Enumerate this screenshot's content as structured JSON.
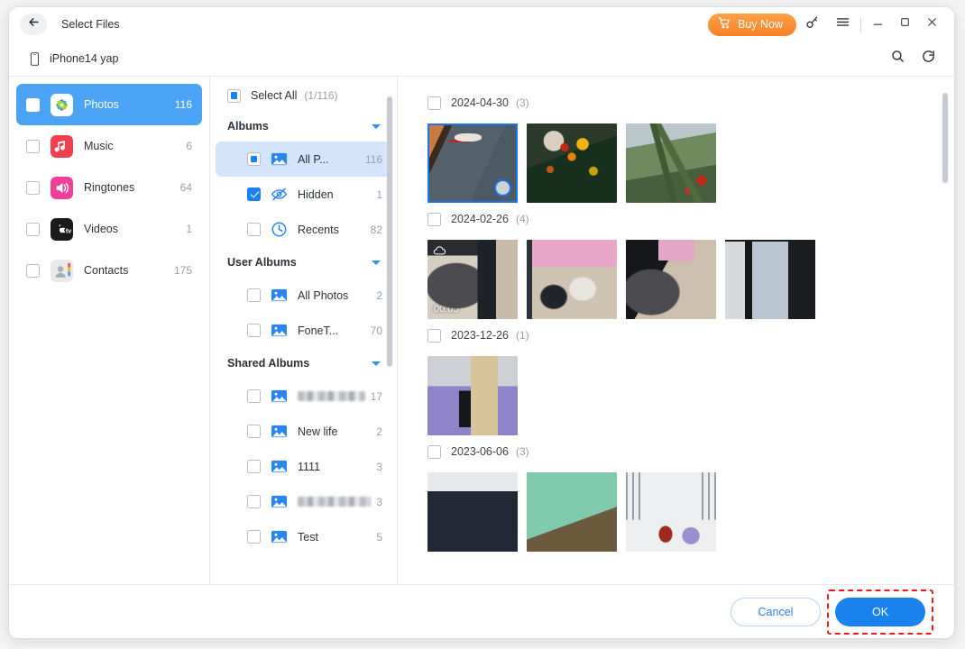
{
  "titlebar": {
    "back_icon": "arrow-left-icon",
    "title": "Select Files",
    "buy_now_label": "Buy Now",
    "cart_icon": "shopping-cart-icon",
    "key_icon": "key-icon",
    "menu_icon": "hamburger-menu-icon",
    "minimize_icon": "minimize-icon",
    "maximize_icon": "maximize-icon",
    "close_icon": "close-icon",
    "accent_orange": "#f98024"
  },
  "devicebar": {
    "device_icon": "phone-icon",
    "device_name": "iPhone14 yap",
    "search_icon": "search-icon",
    "refresh_icon": "refresh-icon"
  },
  "sidebar": {
    "items": [
      {
        "label": "Photos",
        "count": "116",
        "icon": "photos-app-icon",
        "checked": "indeterminate",
        "active": true
      },
      {
        "label": "Music",
        "count": "6",
        "icon": "music-app-icon",
        "checked": "unchecked",
        "active": false
      },
      {
        "label": "Ringtones",
        "count": "64",
        "icon": "ringtones-app-icon",
        "checked": "unchecked",
        "active": false
      },
      {
        "label": "Videos",
        "count": "1",
        "icon": "appletv-app-icon",
        "checked": "unchecked",
        "active": false
      },
      {
        "label": "Contacts",
        "count": "175",
        "icon": "contacts-app-icon",
        "checked": "unchecked",
        "active": false
      }
    ],
    "active_bg": "#4aa3f5"
  },
  "albums_panel": {
    "select_all_label": "Select All",
    "select_all_count": "(1/116)",
    "select_all_state": "indeterminate",
    "groups": [
      {
        "title": "Albums",
        "items": [
          {
            "label": "All P...",
            "count": "116",
            "icon": "image-icon",
            "checked": "indeterminate",
            "selected": true,
            "redacted": false
          },
          {
            "label": "Hidden",
            "count": "1",
            "icon": "eye-slash-icon",
            "checked": "checked",
            "selected": false,
            "redacted": false
          },
          {
            "label": "Recents",
            "count": "82",
            "icon": "clock-icon",
            "checked": "unchecked",
            "selected": false,
            "redacted": false
          }
        ]
      },
      {
        "title": "User Albums",
        "items": [
          {
            "label": "All Photos",
            "count": "2",
            "icon": "image-icon",
            "checked": "unchecked",
            "selected": false,
            "redacted": false
          },
          {
            "label": "FoneT...",
            "count": "70",
            "icon": "image-icon",
            "checked": "unchecked",
            "selected": false,
            "redacted": false
          }
        ]
      },
      {
        "title": "Shared Albums",
        "items": [
          {
            "label": "",
            "count": "17",
            "icon": "image-icon",
            "checked": "unchecked",
            "selected": false,
            "redacted": true
          },
          {
            "label": "New life",
            "count": "2",
            "icon": "image-icon",
            "checked": "unchecked",
            "selected": false,
            "redacted": false
          },
          {
            "label": "1111",
            "count": "3",
            "icon": "image-icon",
            "checked": "unchecked",
            "selected": false,
            "redacted": false
          },
          {
            "label": "",
            "count": "3",
            "icon": "image-icon",
            "checked": "unchecked",
            "selected": false,
            "redacted": true
          },
          {
            "label": "Test",
            "count": "5",
            "icon": "image-icon",
            "checked": "unchecked",
            "selected": false,
            "redacted": false
          }
        ]
      }
    ]
  },
  "photos_panel": {
    "groups": [
      {
        "date": "2024-04-30",
        "count": "(3)",
        "checked": "unchecked",
        "thumbs": [
          {
            "art": "t-rain",
            "selected": true,
            "cloud": false,
            "duration": ""
          },
          {
            "art": "t-arch",
            "selected": false,
            "cloud": false,
            "duration": ""
          },
          {
            "art": "t-plant",
            "selected": false,
            "cloud": false,
            "duration": ""
          }
        ]
      },
      {
        "date": "2024-02-26",
        "count": "(4)",
        "checked": "unchecked",
        "thumbs": [
          {
            "art": "t-desk1",
            "selected": false,
            "cloud": true,
            "duration": "00:05"
          },
          {
            "art": "t-desk2",
            "selected": false,
            "cloud": false,
            "duration": ""
          },
          {
            "art": "t-desk3",
            "selected": false,
            "cloud": false,
            "duration": ""
          },
          {
            "art": "t-window",
            "selected": false,
            "cloud": false,
            "duration": ""
          }
        ]
      },
      {
        "date": "2023-12-26",
        "count": "(1)",
        "checked": "unchecked",
        "thumbs": [
          {
            "art": "t-office",
            "selected": false,
            "cloud": false,
            "duration": ""
          }
        ]
      },
      {
        "date": "2023-06-06",
        "count": "(3)",
        "checked": "unchecked",
        "thumbs": [
          {
            "art": "t-cat",
            "selected": false,
            "cloud": false,
            "duration": ""
          },
          {
            "art": "t-sea",
            "selected": false,
            "cloud": false,
            "duration": ""
          },
          {
            "art": "t-room",
            "selected": false,
            "cloud": false,
            "duration": ""
          }
        ]
      }
    ]
  },
  "footer": {
    "cancel_label": "Cancel",
    "ok_label": "OK",
    "ok_highlight_color": "#ee1b1b",
    "ok_bg": "#1a82ef"
  }
}
